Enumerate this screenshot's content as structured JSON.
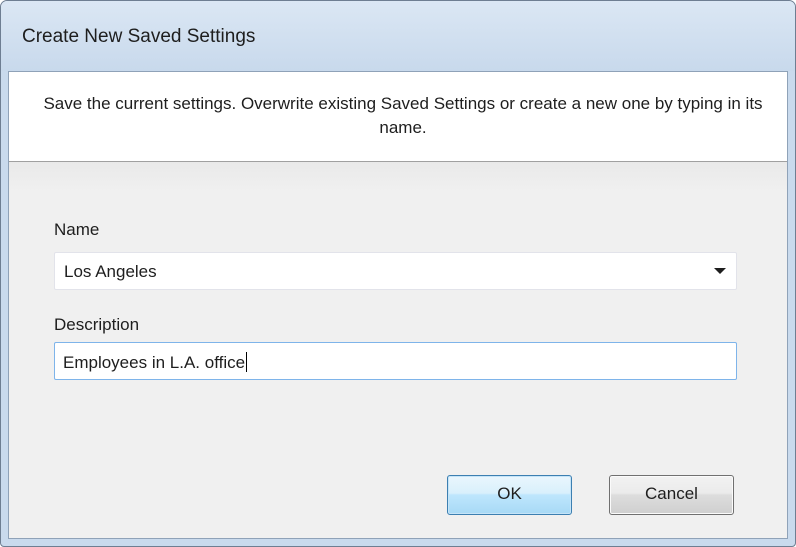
{
  "window": {
    "title": "Create New Saved Settings"
  },
  "header": {
    "message": "Save the current settings.  Overwrite existing Saved Settings or create a new one by typing in its name."
  },
  "form": {
    "name_label": "Name",
    "name_value": "Los Angeles",
    "description_label": "Description",
    "description_value": "Employees in L.A. office"
  },
  "buttons": {
    "ok_label": "OK",
    "cancel_label": "Cancel"
  },
  "colors": {
    "title_bar": "#c9daed",
    "focus_border": "#7eb4ea",
    "default_button_border": "#3c7fb1"
  }
}
